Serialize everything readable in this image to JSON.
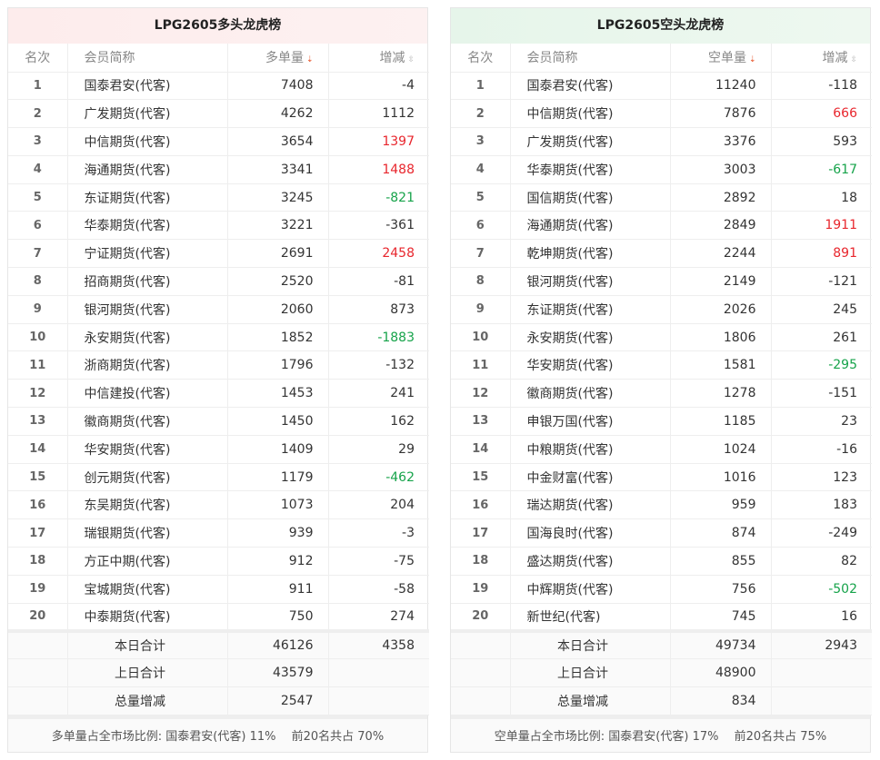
{
  "colors": {
    "up": "#e8262d",
    "down": "#16a34a"
  },
  "long": {
    "title": "LPG2605多头龙虎榜",
    "headers": {
      "rank": "名次",
      "member": "会员简称",
      "volume": "多单量",
      "change": "增减"
    },
    "rows": [
      {
        "rank": "1",
        "member": "国泰君安(代客)",
        "volume": "7408",
        "change": "-4",
        "hl": ""
      },
      {
        "rank": "2",
        "member": "广发期货(代客)",
        "volume": "4262",
        "change": "1112",
        "hl": ""
      },
      {
        "rank": "3",
        "member": "中信期货(代客)",
        "volume": "3654",
        "change": "1397",
        "hl": "red"
      },
      {
        "rank": "4",
        "member": "海通期货(代客)",
        "volume": "3341",
        "change": "1488",
        "hl": "red"
      },
      {
        "rank": "5",
        "member": "东证期货(代客)",
        "volume": "3245",
        "change": "-821",
        "hl": "green"
      },
      {
        "rank": "6",
        "member": "华泰期货(代客)",
        "volume": "3221",
        "change": "-361",
        "hl": ""
      },
      {
        "rank": "7",
        "member": "宁证期货(代客)",
        "volume": "2691",
        "change": "2458",
        "hl": "red"
      },
      {
        "rank": "8",
        "member": "招商期货(代客)",
        "volume": "2520",
        "change": "-81",
        "hl": ""
      },
      {
        "rank": "9",
        "member": "银河期货(代客)",
        "volume": "2060",
        "change": "873",
        "hl": ""
      },
      {
        "rank": "10",
        "member": "永安期货(代客)",
        "volume": "1852",
        "change": "-1883",
        "hl": "green"
      },
      {
        "rank": "11",
        "member": "浙商期货(代客)",
        "volume": "1796",
        "change": "-132",
        "hl": ""
      },
      {
        "rank": "12",
        "member": "中信建投(代客)",
        "volume": "1453",
        "change": "241",
        "hl": ""
      },
      {
        "rank": "13",
        "member": "徽商期货(代客)",
        "volume": "1450",
        "change": "162",
        "hl": ""
      },
      {
        "rank": "14",
        "member": "华安期货(代客)",
        "volume": "1409",
        "change": "29",
        "hl": ""
      },
      {
        "rank": "15",
        "member": "创元期货(代客)",
        "volume": "1179",
        "change": "-462",
        "hl": "green"
      },
      {
        "rank": "16",
        "member": "东吴期货(代客)",
        "volume": "1073",
        "change": "204",
        "hl": ""
      },
      {
        "rank": "17",
        "member": "瑞银期货(代客)",
        "volume": "939",
        "change": "-3",
        "hl": ""
      },
      {
        "rank": "18",
        "member": "方正中期(代客)",
        "volume": "912",
        "change": "-75",
        "hl": ""
      },
      {
        "rank": "19",
        "member": "宝城期货(代客)",
        "volume": "911",
        "change": "-58",
        "hl": ""
      },
      {
        "rank": "20",
        "member": "中泰期货(代客)",
        "volume": "750",
        "change": "274",
        "hl": ""
      }
    ],
    "summary": [
      {
        "label": "本日合计",
        "volume": "46126",
        "change": "4358"
      },
      {
        "label": "上日合计",
        "volume": "43579",
        "change": ""
      },
      {
        "label": "总量增减",
        "volume": "2547",
        "change": ""
      }
    ],
    "footer": "多单量占全市场比例: 国泰君安(代客) 11%　 前20名共占 70%"
  },
  "short": {
    "title": "LPG2605空头龙虎榜",
    "headers": {
      "rank": "名次",
      "member": "会员简称",
      "volume": "空单量",
      "change": "增减"
    },
    "rows": [
      {
        "rank": "1",
        "member": "国泰君安(代客)",
        "volume": "11240",
        "change": "-118",
        "hl": ""
      },
      {
        "rank": "2",
        "member": "中信期货(代客)",
        "volume": "7876",
        "change": "666",
        "hl": "red"
      },
      {
        "rank": "3",
        "member": "广发期货(代客)",
        "volume": "3376",
        "change": "593",
        "hl": ""
      },
      {
        "rank": "4",
        "member": "华泰期货(代客)",
        "volume": "3003",
        "change": "-617",
        "hl": "green"
      },
      {
        "rank": "5",
        "member": "国信期货(代客)",
        "volume": "2892",
        "change": "18",
        "hl": ""
      },
      {
        "rank": "6",
        "member": "海通期货(代客)",
        "volume": "2849",
        "change": "1911",
        "hl": "red"
      },
      {
        "rank": "7",
        "member": "乾坤期货(代客)",
        "volume": "2244",
        "change": "891",
        "hl": "red"
      },
      {
        "rank": "8",
        "member": "银河期货(代客)",
        "volume": "2149",
        "change": "-121",
        "hl": ""
      },
      {
        "rank": "9",
        "member": "东证期货(代客)",
        "volume": "2026",
        "change": "245",
        "hl": ""
      },
      {
        "rank": "10",
        "member": "永安期货(代客)",
        "volume": "1806",
        "change": "261",
        "hl": ""
      },
      {
        "rank": "11",
        "member": "华安期货(代客)",
        "volume": "1581",
        "change": "-295",
        "hl": "green"
      },
      {
        "rank": "12",
        "member": "徽商期货(代客)",
        "volume": "1278",
        "change": "-151",
        "hl": ""
      },
      {
        "rank": "13",
        "member": "申银万国(代客)",
        "volume": "1185",
        "change": "23",
        "hl": ""
      },
      {
        "rank": "14",
        "member": "中粮期货(代客)",
        "volume": "1024",
        "change": "-16",
        "hl": ""
      },
      {
        "rank": "15",
        "member": "中金财富(代客)",
        "volume": "1016",
        "change": "123",
        "hl": ""
      },
      {
        "rank": "16",
        "member": "瑞达期货(代客)",
        "volume": "959",
        "change": "183",
        "hl": ""
      },
      {
        "rank": "17",
        "member": "国海良时(代客)",
        "volume": "874",
        "change": "-249",
        "hl": ""
      },
      {
        "rank": "18",
        "member": "盛达期货(代客)",
        "volume": "855",
        "change": "82",
        "hl": ""
      },
      {
        "rank": "19",
        "member": "中辉期货(代客)",
        "volume": "756",
        "change": "-502",
        "hl": "green"
      },
      {
        "rank": "20",
        "member": "新世纪(代客)",
        "volume": "745",
        "change": "16",
        "hl": ""
      }
    ],
    "summary": [
      {
        "label": "本日合计",
        "volume": "49734",
        "change": "2943"
      },
      {
        "label": "上日合计",
        "volume": "48900",
        "change": ""
      },
      {
        "label": "总量增减",
        "volume": "834",
        "change": ""
      }
    ],
    "footer": "空单量占全市场比例: 国泰君安(代客) 17%　 前20名共占 75%"
  }
}
